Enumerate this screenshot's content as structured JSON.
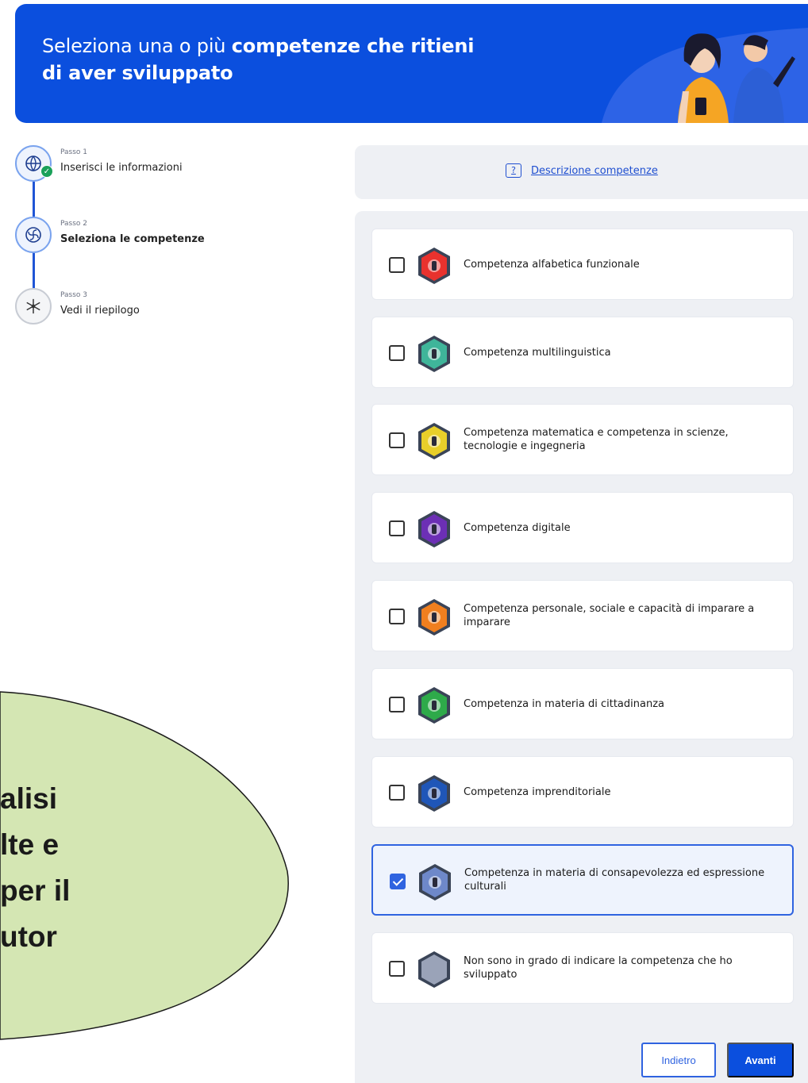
{
  "header": {
    "title_regular": "Seleziona una o più ",
    "title_bold_line1": "competenze che ritieni",
    "title_bold_line2": "di aver sviluppato"
  },
  "stepper": {
    "steps": [
      {
        "small": "Passo 1",
        "label": "Inserisci le informazioni",
        "icon": "globe-icon",
        "status": "completed"
      },
      {
        "small": "Passo 2",
        "label": "Seleziona le competenze",
        "icon": "fan-icon",
        "status": "current"
      },
      {
        "small": "Passo 3",
        "label": "Vedi il riepilogo",
        "icon": "snowflake-icon",
        "status": "pending"
      }
    ]
  },
  "description_link": {
    "icon_glyph": "?",
    "label": "Descrizione competenze"
  },
  "competences": [
    {
      "label": "Competenza alfabetica funzionale",
      "checked": false,
      "color": "#e8322e",
      "icon": "pen-badge-icon"
    },
    {
      "label": "Competenza multilinguistica",
      "checked": false,
      "color": "#3fb59a",
      "icon": "globe-badge-icon"
    },
    {
      "label": "Competenza matematica e competenza in scienze, tecnologie e ingegneria",
      "checked": false,
      "color": "#e8cf2a",
      "icon": "atom-badge-icon"
    },
    {
      "label": "Competenza digitale",
      "checked": false,
      "color": "#6c2fb5",
      "icon": "computer-badge-icon"
    },
    {
      "label": "Competenza personale, sociale e capacità di imparare a imparare",
      "checked": false,
      "color": "#f07f1f",
      "icon": "graduation-badge-icon"
    },
    {
      "label": "Competenza in materia di cittadinanza",
      "checked": false,
      "color": "#2eaa4a",
      "icon": "medal-badge-icon"
    },
    {
      "label": "Competenza imprenditoriale",
      "checked": false,
      "color": "#1f56b8",
      "icon": "rocket-badge-icon"
    },
    {
      "label": "Competenza in materia di consapevolezza ed espressione culturali",
      "checked": true,
      "color": "#6e88c9",
      "icon": "theater-badge-icon"
    },
    {
      "label": "Non sono in grado di indicare la competenza che ho sviluppato",
      "checked": false,
      "color": "#9aa3b8",
      "icon": "hexagon-badge-icon"
    }
  ],
  "buttons": {
    "back": "Indietro",
    "next": "Avanti"
  },
  "callout": {
    "lines": [
      "alisi",
      "lte e",
      "per il",
      "utor"
    ],
    "color": "#d4e6b3"
  }
}
